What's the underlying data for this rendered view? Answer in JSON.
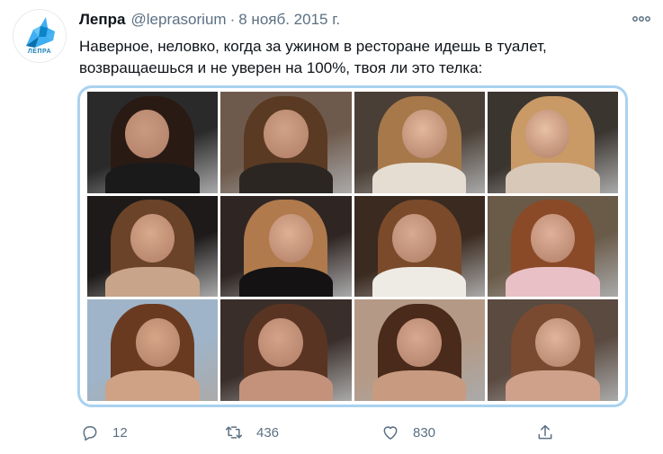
{
  "tweet": {
    "avatar_logo_text": "ЛЕПРА",
    "author_name": "Лепра",
    "author_handle": "@leprasorium",
    "separator": "·",
    "date": "8 нояб. 2015 г.",
    "text": "Наверное, неловко, когда за ужином в ресторане идешь в туалет, возвращаешься и не уверен на 100%, твоя ли это телка:",
    "more_icon": "more-dots-icon",
    "media": {
      "description_count": 12,
      "photos": [
        {
          "bg": "#2b2a2b",
          "hair": "#2a1a14",
          "skin": "#c99a80",
          "top": "#1a1a1a"
        },
        {
          "bg": "#6e5a4c",
          "hair": "#5a3a22",
          "skin": "#d0a286",
          "top": "#2b2622"
        },
        {
          "bg": "#4a3f36",
          "hair": "#a6784a",
          "skin": "#e2b89c",
          "top": "#e6ddd2"
        },
        {
          "bg": "#3b3530",
          "hair": "#c99a66",
          "skin": "#e8c0a4",
          "top": "#d8c8b8"
        },
        {
          "bg": "#1d1a19",
          "hair": "#6b4328",
          "skin": "#d8a98c",
          "top": "#c8a48a"
        },
        {
          "bg": "#2f2523",
          "hair": "#b07a4c",
          "skin": "#dfb094",
          "top": "#141212"
        },
        {
          "bg": "#3a2a20",
          "hair": "#7a4a2a",
          "skin": "#d8aa92",
          "top": "#eeeae4"
        },
        {
          "bg": "#6a5a48",
          "hair": "#8a4a28",
          "skin": "#e0b09a",
          "top": "#e8c0c6"
        },
        {
          "bg": "#9fb4c8",
          "hair": "#6a3a20",
          "skin": "#d6a486",
          "top": "#cfa286"
        },
        {
          "bg": "#3a2e2a",
          "hair": "#5a3422",
          "skin": "#d4a288",
          "top": "#c4927a"
        },
        {
          "bg": "#b49a86",
          "hair": "#4a2a1a",
          "skin": "#d8a890",
          "top": "#c89a80"
        },
        {
          "bg": "#5a4a40",
          "hair": "#7a4a30",
          "skin": "#e0b49c",
          "top": "#cfa08a"
        }
      ]
    }
  },
  "actions": {
    "reply": {
      "icon": "reply-icon",
      "count": "12"
    },
    "retweet": {
      "icon": "retweet-icon",
      "count": "436"
    },
    "like": {
      "icon": "heart-icon",
      "count": "830"
    },
    "share": {
      "icon": "share-icon"
    }
  },
  "colors": {
    "accent": "#1da1f2",
    "muted": "#5b7083",
    "media_border": "#a9d2ef"
  }
}
